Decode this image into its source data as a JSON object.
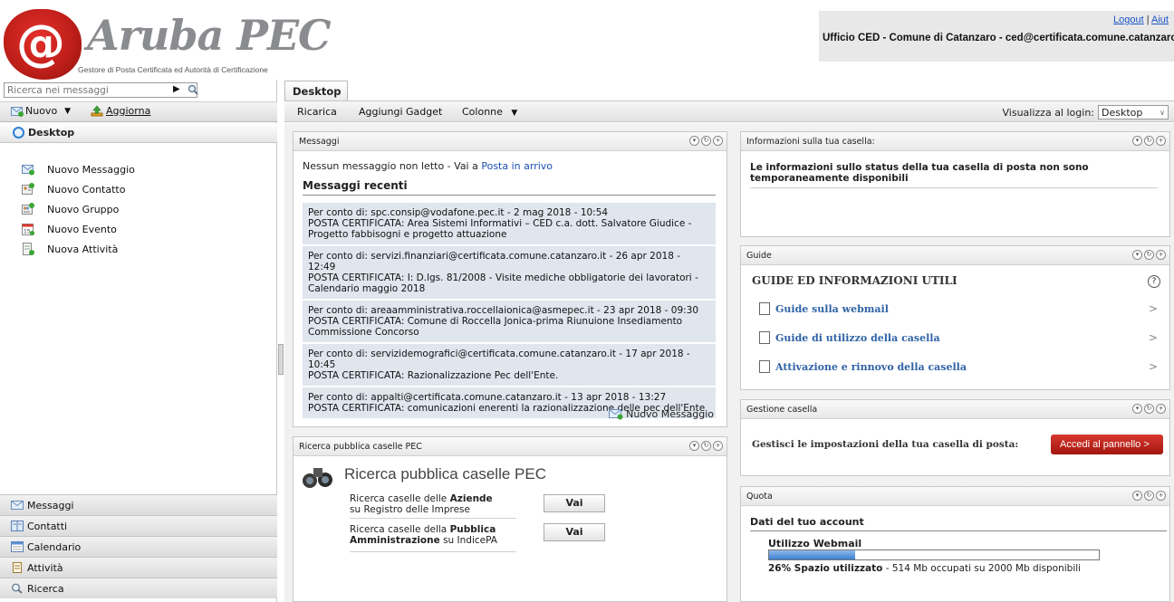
{
  "header": {
    "logo_text": "Aruba PEC",
    "logo_subtitle": "Gestore di Posta Certificata ed Autorità di Certificazione",
    "logout_label": "Logout",
    "link_separator": "|",
    "help_label": "Aiut",
    "account": "Ufficio CED - Comune di Catanzaro - ced@certificata.comune.catanzaro."
  },
  "sidebar": {
    "search_placeholder": "Ricerca nei messaggi",
    "toolbar": {
      "new_label": "Nuovo",
      "refresh_label": "Aggiorna"
    },
    "desktop_label": "Desktop",
    "quick_actions": [
      {
        "label": "Nuovo Messaggio",
        "icon": "new-message-icon"
      },
      {
        "label": "Nuovo Contatto",
        "icon": "new-contact-icon"
      },
      {
        "label": "Nuovo Gruppo",
        "icon": "new-group-icon"
      },
      {
        "label": "Nuovo Evento",
        "icon": "new-event-icon"
      },
      {
        "label": "Nuova Attività",
        "icon": "new-task-icon"
      }
    ],
    "nav": [
      {
        "label": "Messaggi",
        "icon": "mail-icon"
      },
      {
        "label": "Contatti",
        "icon": "contacts-icon"
      },
      {
        "label": "Calendario",
        "icon": "calendar-icon"
      },
      {
        "label": "Attività",
        "icon": "tasks-icon"
      },
      {
        "label": "Ricerca",
        "icon": "search-icon"
      }
    ]
  },
  "main": {
    "tab_label": "Desktop",
    "toolbar": {
      "reload_label": "Ricarica",
      "add_gadget_label": "Aggiungi Gadget",
      "columns_label": "Colonne",
      "view_at_login_label": "Visualizza al login:",
      "view_at_login_value": "Desktop"
    },
    "messaggi": {
      "title": "Messaggi",
      "no_unread": "Nessun messaggio non letto - Vai a ",
      "inbox_link": "Posta in arrivo",
      "recent_title": "Messaggi recenti",
      "items": [
        {
          "line1": "Per conto di: spc.consip@vodafone.pec.it - 2 mag 2018 - 10:54",
          "line2": "POSTA CERTIFICATA: Area Sistemi Informativi – CED c.a. dott. Salvatore Giudice - Progetto fabbisogni e progetto attuazione"
        },
        {
          "line1": "Per conto di: servizi.finanziari@certificata.comune.catanzaro.it - 26 apr 2018 - 12:49",
          "line2": "POSTA CERTIFICATA: I: D.lgs. 81/2008 - Visite mediche obbligatorie dei lavoratori - Calendario maggio 2018"
        },
        {
          "line1": "Per conto di: areaamministrativa.roccellaionica@asmepec.it - 23 apr 2018 - 09:30",
          "line2": "POSTA CERTIFICATA: Comune di Roccella Jonica-prima Riunuione Insediamento Commissione Concorso"
        },
        {
          "line1": "Per conto di: servizidemografici@certificata.comune.catanzaro.it - 17 apr 2018 - 10:45",
          "line2": "POSTA CERTIFICATA: Razionalizzazione Pec dell'Ente."
        },
        {
          "line1": "Per conto di: appalti@certificata.comune.catanzaro.it - 13 apr 2018 - 13:27",
          "line2": "POSTA CERTIFICATA: comunicazioni enerenti la razionalizzazione delle pec dell'Ente"
        }
      ],
      "new_message_label": "Nuovo Messaggio"
    },
    "ricerca": {
      "title": "Ricerca pubblica caselle PEC",
      "heading": "Ricerca pubblica caselle PEC",
      "row1_pre": "Ricerca caselle delle ",
      "row1_bold": "Aziende",
      "row1_post": "su Registro delle Imprese",
      "row2_pre": "Ricerca caselle della ",
      "row2_bold": "Pubblica Amministrazione",
      "row2_post": " su IndicePA",
      "button_label": "Vai"
    },
    "info": {
      "title": "Informazioni sulla tua casella:",
      "text": "Le informazioni sullo status della tua casella di posta non sono temporaneamente disponibili"
    },
    "guide": {
      "title": "Guide",
      "heading": "GUIDE ED INFORMAZIONI UTILI",
      "help": "?",
      "links": [
        {
          "label": "Guide sulla webmail"
        },
        {
          "label": "Guide di utilizzo della casella"
        },
        {
          "label": "Attivazione e rinnovo della casella"
        }
      ],
      "arrow": ">"
    },
    "gestione": {
      "title": "Gestione casella",
      "text": "Gestisci le impostazioni della tua casella di posta:",
      "button_label": "Accedi al pannello  >"
    },
    "quota": {
      "title": "Quota",
      "heading": "Dati del tuo account",
      "label": "Utilizzo Webmail",
      "used_fraction": 0.26,
      "used_text": "26% Spazio utilizzato",
      "detail_text": " - 514 Mb occupati su 2000 Mb disponibili"
    }
  },
  "colors": {
    "brand_red": "#c01f1a",
    "link_blue": "#1a4fb0",
    "guide_blue": "#2f63a6",
    "message_bg": "#dfe6ee"
  }
}
